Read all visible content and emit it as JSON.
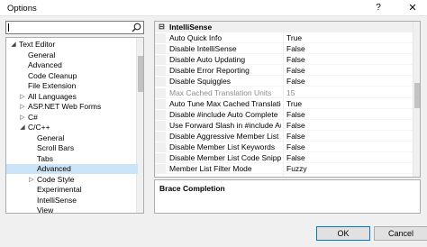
{
  "window": {
    "title": "Options",
    "help_label": "?",
    "close_label": "✕"
  },
  "search": {
    "value": ""
  },
  "tree": [
    {
      "label": "Text Editor",
      "level": 0,
      "expander": "collapse"
    },
    {
      "label": "General",
      "level": 1
    },
    {
      "label": "Advanced",
      "level": 1
    },
    {
      "label": "Code Cleanup",
      "level": 1
    },
    {
      "label": "File Extension",
      "level": 1
    },
    {
      "label": "All Languages",
      "level": 1,
      "expander": "expand"
    },
    {
      "label": "ASP.NET Web Forms",
      "level": 1,
      "expander": "expand"
    },
    {
      "label": "C#",
      "level": 1,
      "expander": "expand"
    },
    {
      "label": "C/C++",
      "level": 1,
      "expander": "collapse"
    },
    {
      "label": "General",
      "level": 2
    },
    {
      "label": "Scroll Bars",
      "level": 2
    },
    {
      "label": "Tabs",
      "level": 2
    },
    {
      "label": "Advanced",
      "level": 2,
      "selected": true
    },
    {
      "label": "Code Style",
      "level": 2,
      "expander": "expand"
    },
    {
      "label": "Experimental",
      "level": 2
    },
    {
      "label": "IntelliSense",
      "level": 2
    },
    {
      "label": "View",
      "level": 2
    }
  ],
  "grid": {
    "category": "IntelliSense",
    "category_toggle": "⊟",
    "properties": [
      {
        "name": "Auto Quick Info",
        "value": "True"
      },
      {
        "name": "Disable IntelliSense",
        "value": "False"
      },
      {
        "name": "Disable Auto Updating",
        "value": "False"
      },
      {
        "name": "Disable Error Reporting",
        "value": "False"
      },
      {
        "name": "Disable Squiggles",
        "value": "False"
      },
      {
        "name": "Max Cached Translation Units",
        "value": "15",
        "disabled": true
      },
      {
        "name": "Auto Tune Max Cached Translation Units",
        "value": "True"
      },
      {
        "name": "Disable #include Auto Complete",
        "value": "False"
      },
      {
        "name": "Use Forward Slash in #include Auto Complete",
        "value": "False"
      },
      {
        "name": "Disable Aggressive Member List",
        "value": "False"
      },
      {
        "name": "Disable Member List Keywords",
        "value": "False"
      },
      {
        "name": "Disable Member List Code Snippets",
        "value": "False"
      },
      {
        "name": "Member List Filter Mode",
        "value": "Fuzzy"
      }
    ]
  },
  "description": {
    "title": "Brace Completion"
  },
  "buttons": {
    "ok": "OK",
    "cancel": "Cancel"
  },
  "colors": {
    "selection": "#cce4f7",
    "accent": "#0078d7"
  }
}
